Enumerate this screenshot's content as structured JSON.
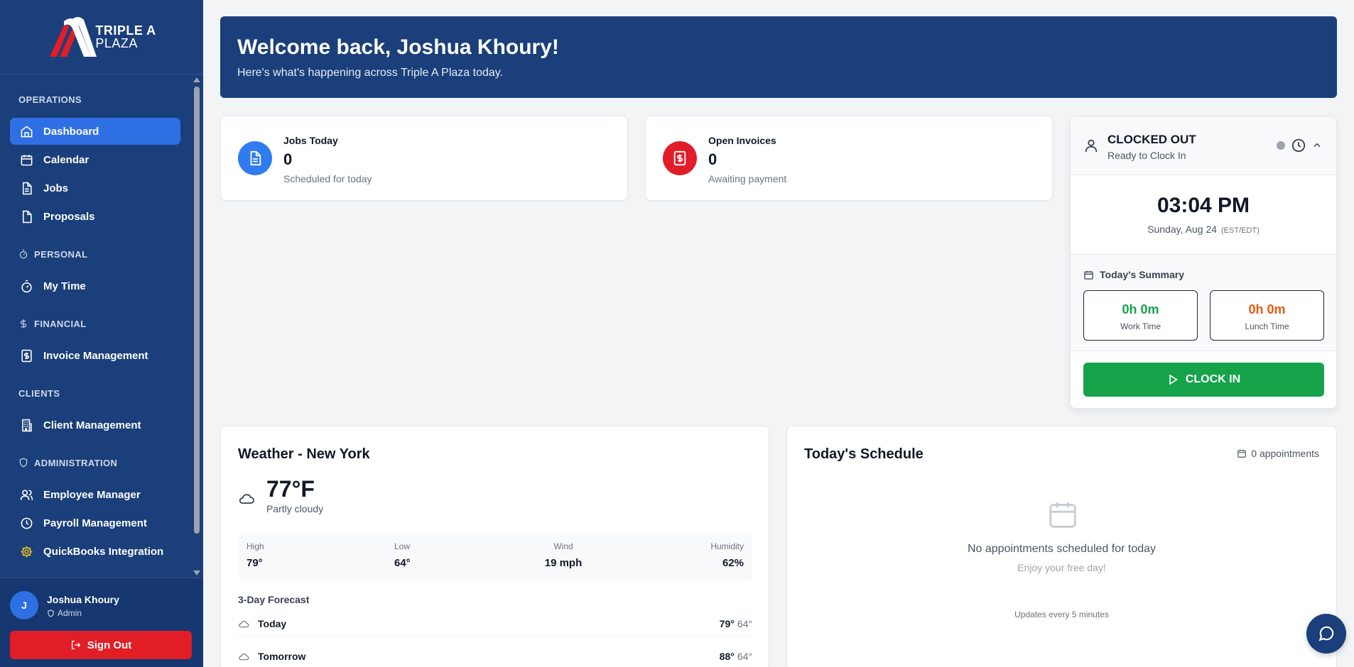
{
  "brand": {
    "line1": "TRIPLE A",
    "line2": "PLAZA"
  },
  "sidebar": {
    "sections": [
      {
        "label": "OPERATIONS",
        "items": [
          {
            "label": "Dashboard",
            "icon": "home-icon",
            "active": true
          },
          {
            "label": "Calendar",
            "icon": "calendar-icon"
          },
          {
            "label": "Jobs",
            "icon": "document-icon"
          },
          {
            "label": "Proposals",
            "icon": "file-icon"
          }
        ]
      },
      {
        "label": "PERSONAL",
        "icon": "stopwatch-icon",
        "items": [
          {
            "label": "My Time",
            "icon": "stopwatch-icon"
          }
        ]
      },
      {
        "label": "FINANCIAL",
        "icon": "dollar-icon",
        "items": [
          {
            "label": "Invoice Management",
            "icon": "invoice-icon"
          }
        ]
      },
      {
        "label": "CLIENTS",
        "items": [
          {
            "label": "Client Management",
            "icon": "building-icon"
          }
        ]
      },
      {
        "label": "ADMINISTRATION",
        "icon": "shield-icon",
        "items": [
          {
            "label": "Employee Manager",
            "icon": "users-icon"
          },
          {
            "label": "Payroll Management",
            "icon": "clock-icon"
          },
          {
            "label": "QuickBooks Integration",
            "icon": "gear-icon"
          }
        ]
      }
    ]
  },
  "user": {
    "initial": "J",
    "name": "Joshua Khoury",
    "role": "Admin",
    "signout_label": "Sign Out"
  },
  "banner": {
    "title": "Welcome back, Joshua Khoury!",
    "subtitle": "Here's what's happening across Triple A Plaza today."
  },
  "stats": {
    "jobs": {
      "title": "Jobs Today",
      "value": "0",
      "sub": "Scheduled for today",
      "color": "#2f7bef"
    },
    "invoices": {
      "title": "Open Invoices",
      "value": "0",
      "sub": "Awaiting payment",
      "color": "#e11d2a"
    }
  },
  "clock": {
    "status": "CLOCKED OUT",
    "ready": "Ready to Clock In",
    "time": "03:04 PM",
    "date": "Sunday, Aug 24",
    "tz": "(EST/EDT)",
    "summary_title": "Today's Summary",
    "work_value": "0h 0m",
    "work_label": "Work Time",
    "work_color": "#16a34a",
    "lunch_value": "0h 0m",
    "lunch_label": "Lunch Time",
    "lunch_color": "#ea580c",
    "button_label": "CLOCK IN"
  },
  "weather": {
    "title": "Weather - New York",
    "temp": "77°F",
    "condition": "Partly cloudy",
    "high_label": "High",
    "high": "79°",
    "low_label": "Low",
    "low": "64°",
    "wind_label": "Wind",
    "wind": "19 mph",
    "humidity_label": "Humidity",
    "humidity": "62%",
    "forecast_title": "3-Day Forecast",
    "forecast": [
      {
        "day": "Today",
        "high": "79°",
        "low": "64°"
      },
      {
        "day": "Tomorrow",
        "high": "88°",
        "low": "64°"
      }
    ]
  },
  "schedule": {
    "title": "Today's Schedule",
    "count": "0 appointments",
    "empty": "No appointments scheduled for today",
    "empty_sub": "Enjoy your free day!",
    "updates": "Updates every 5 minutes"
  }
}
